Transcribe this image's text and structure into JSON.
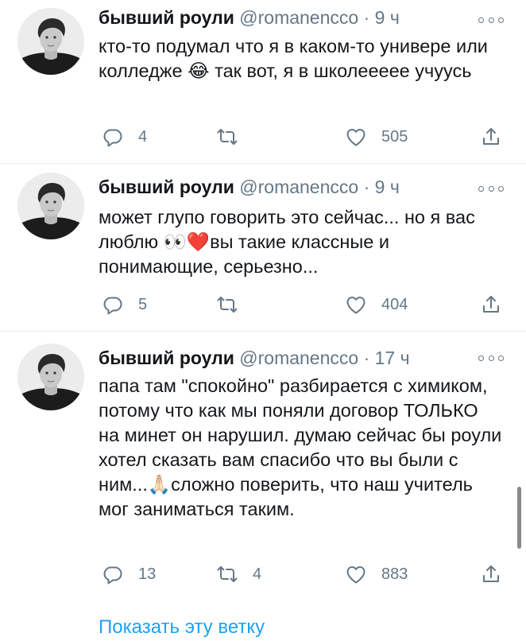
{
  "tweets": [
    {
      "name": "бывший роули",
      "handle": "@romanencco",
      "dot": "·",
      "time": "9 ч",
      "text": "кто-то подумал что я в каком-то универе или колледже 😂 так вот, я в школеееее учуусь",
      "replies": "4",
      "retweets": "",
      "likes": "505"
    },
    {
      "name": "бывший роули",
      "handle": "@romanencco",
      "dot": "·",
      "time": "9 ч",
      "text": "может глупо говорить это сейчас... но я вас люблю 👀❤️вы такие классные и понимающие, серьезно...",
      "replies": "5",
      "retweets": "",
      "likes": "404"
    },
    {
      "name": "бывший роули",
      "handle": "@romanencco",
      "dot": "·",
      "time": "17 ч",
      "text": "папа там \"спокойно\" разбирается с химиком, потому что как мы поняли договор ТОЛЬКО на минет он нарушил. думаю сейчас бы роули хотел сказать вам спасибо что вы были с ним...🙏🏻сложно поверить, что наш учитель мог заниматься таким.",
      "replies": "13",
      "retweets": "4",
      "likes": "883"
    }
  ],
  "show_thread": "Показать эту ветку",
  "colors": {
    "accent": "#1da1f2",
    "muted": "#657786",
    "divider": "#e6ecf0"
  },
  "icons": [
    "avatar-photo",
    "more-icon",
    "reply-icon",
    "retweet-icon",
    "like-icon",
    "share-icon"
  ]
}
